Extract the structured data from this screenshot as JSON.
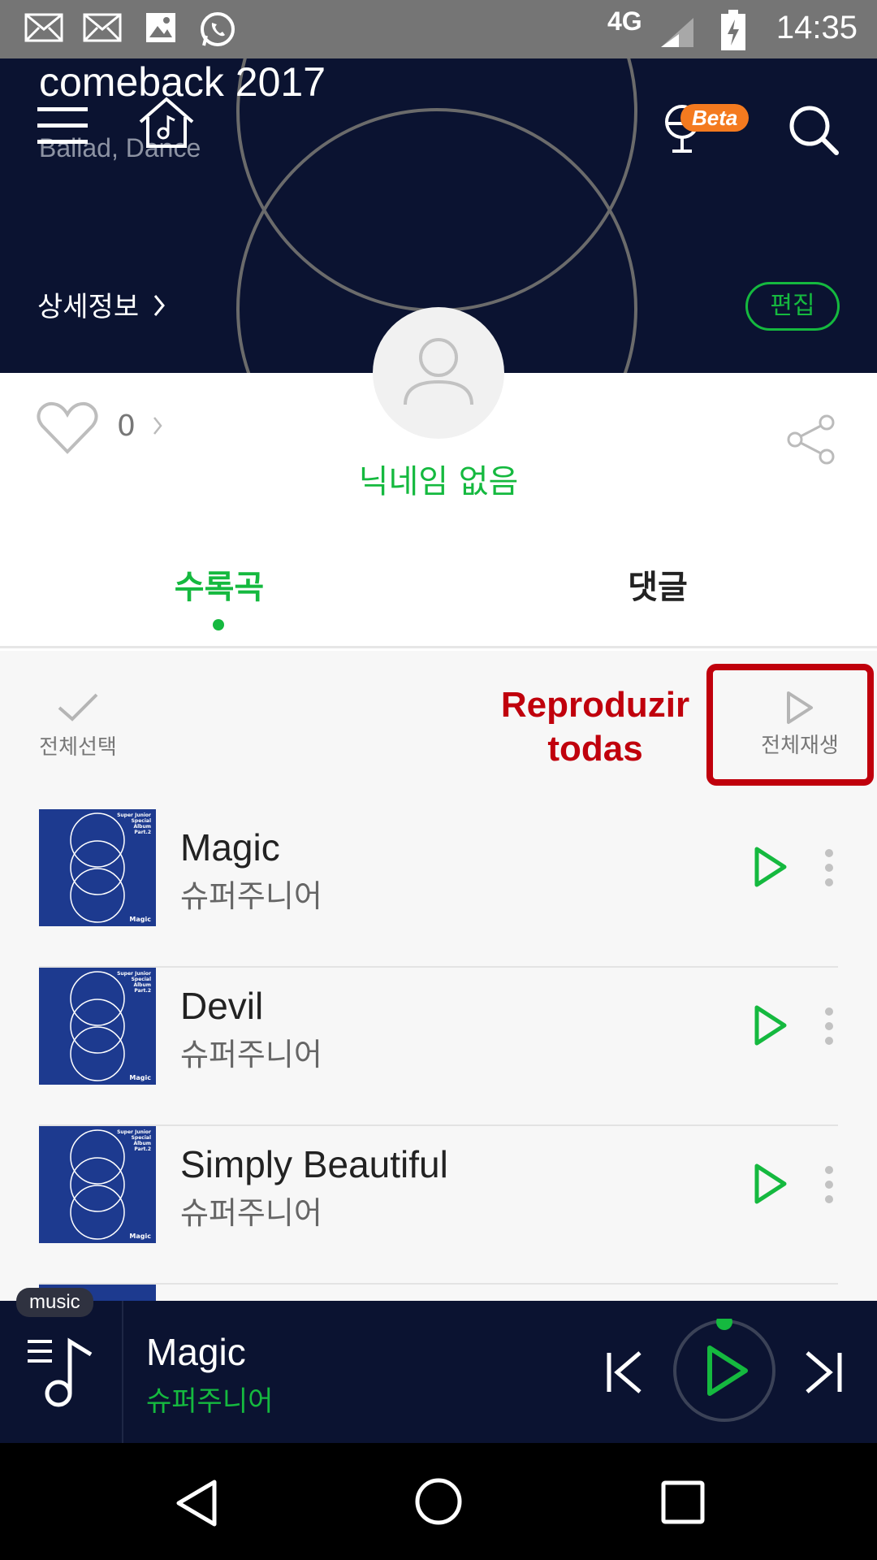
{
  "status_bar": {
    "icons": [
      "mail-icon",
      "mail-icon",
      "image-icon",
      "whatsapp-icon"
    ],
    "network": "4G",
    "time": "14:35"
  },
  "header": {
    "playlist_title": "comeback 2017",
    "genre": "Ballad, Dance",
    "beta_badge": "Beta",
    "detail_link": "상세정보",
    "edit_label": "편집"
  },
  "profile": {
    "like_count": "0",
    "nickname": "닉네임 없음"
  },
  "tabs": [
    {
      "label": "수록곡",
      "active": true
    },
    {
      "label": "댓글",
      "active": false
    }
  ],
  "list_controls": {
    "select_all_label": "전체선택",
    "play_all_label": "전체재생",
    "annotation": [
      "Reproduzir",
      "todas"
    ]
  },
  "album_art_text": {
    "lines": [
      "Super Junior",
      "Special",
      "Album",
      "Part.2"
    ],
    "album": "Magic"
  },
  "tracks": [
    {
      "title": "Magic",
      "artist": "슈퍼주니어"
    },
    {
      "title": "Devil",
      "artist": "슈퍼주니어"
    },
    {
      "title": "Simply Beautiful",
      "artist": "슈퍼주니어"
    }
  ],
  "mini_player": {
    "badge": "music",
    "title": "Magic",
    "artist": "슈퍼주니어"
  },
  "colors": {
    "accent": "#15b93f",
    "header_bg": "#0b1331",
    "annotation": "#c0000c",
    "album_blue": "#1d3a8f"
  }
}
